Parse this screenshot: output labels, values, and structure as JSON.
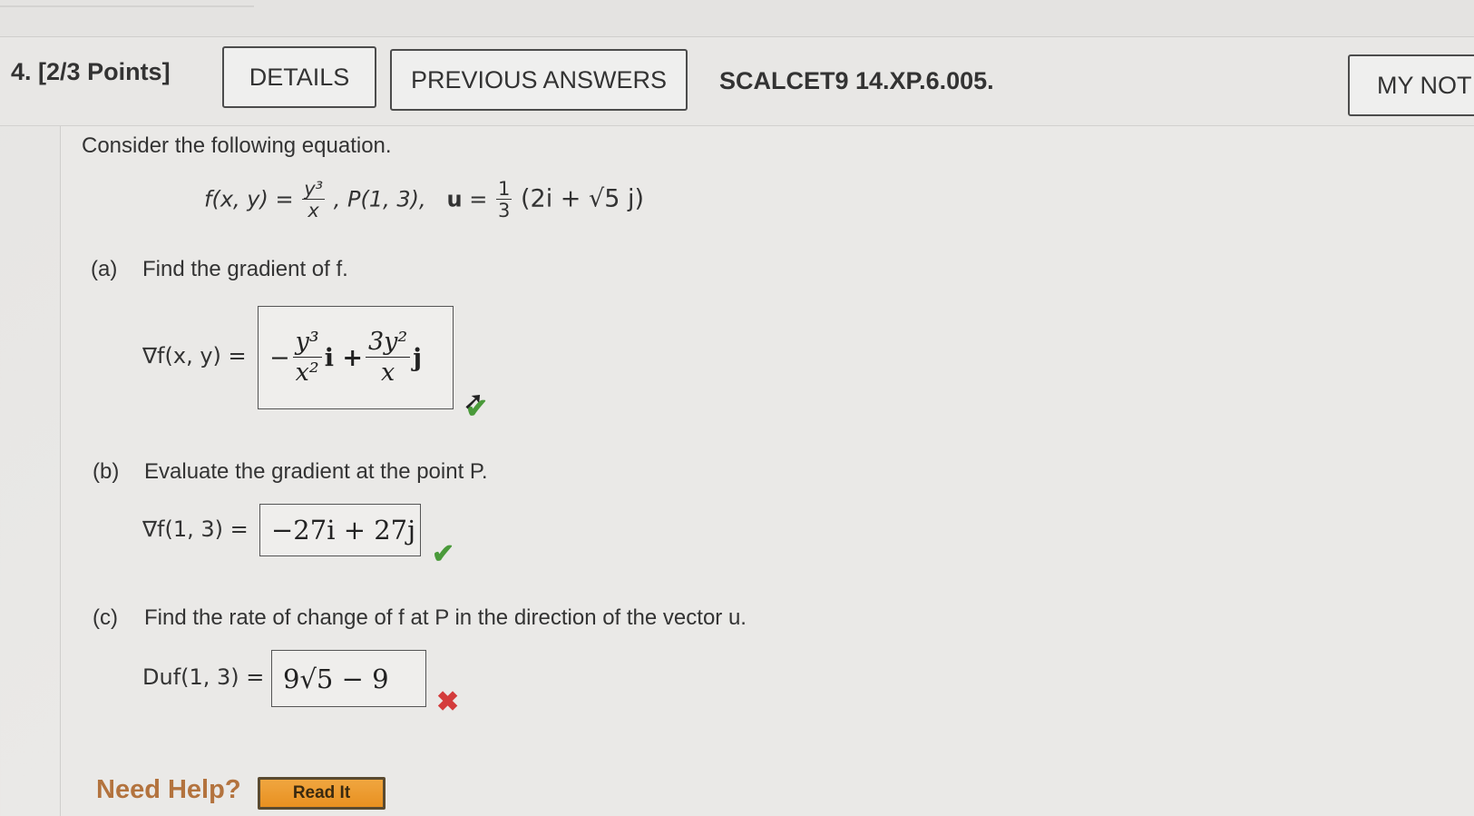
{
  "question": {
    "number_label": "4.",
    "points_label": "[2/3 Points]",
    "source": "SCALCET9 14.XP.6.005."
  },
  "buttons": {
    "details": "DETAILS",
    "previous_answers": "PREVIOUS ANSWERS",
    "my_notes": "MY NOT"
  },
  "problem": {
    "intro": "Consider the following equation.",
    "func_lhs": "f(x, y) =",
    "func_num": "y³",
    "func_den": "x",
    "point": ",   P(1, 3),",
    "u_label": "u",
    "u_eq": "=",
    "u_num": "1",
    "u_den": "3",
    "u_vec": "(2i + √5 j)"
  },
  "part_a": {
    "label": "(a)",
    "text": "Find the gradient of f.",
    "lhs": "∇f(x, y) =",
    "sign": "−",
    "term1_num": "y³",
    "term1_den": "x²",
    "term1_unit": "i +",
    "term2_num": "3y²",
    "term2_den": "x",
    "term2_unit": "j",
    "status": "correct"
  },
  "part_b": {
    "label": "(b)",
    "text": "Evaluate the gradient at the point P.",
    "lhs": "∇f(1, 3) =",
    "answer": "−27i + 27j",
    "status": "correct"
  },
  "part_c": {
    "label": "(c)",
    "text": "Find the rate of change of f at P in the direction of the vector u.",
    "lhs": "Duf(1, 3) =",
    "answer": "9√5 − 9",
    "status": "incorrect"
  },
  "help": {
    "label": "Need Help?",
    "read_it": "Read It"
  },
  "icons": {
    "correct": "check-icon",
    "incorrect": "cross-icon"
  },
  "colors": {
    "correct": "#4a9a3a",
    "incorrect": "#d43c3c",
    "read_it_button": "#e89020",
    "need_help": "#b3733e"
  }
}
